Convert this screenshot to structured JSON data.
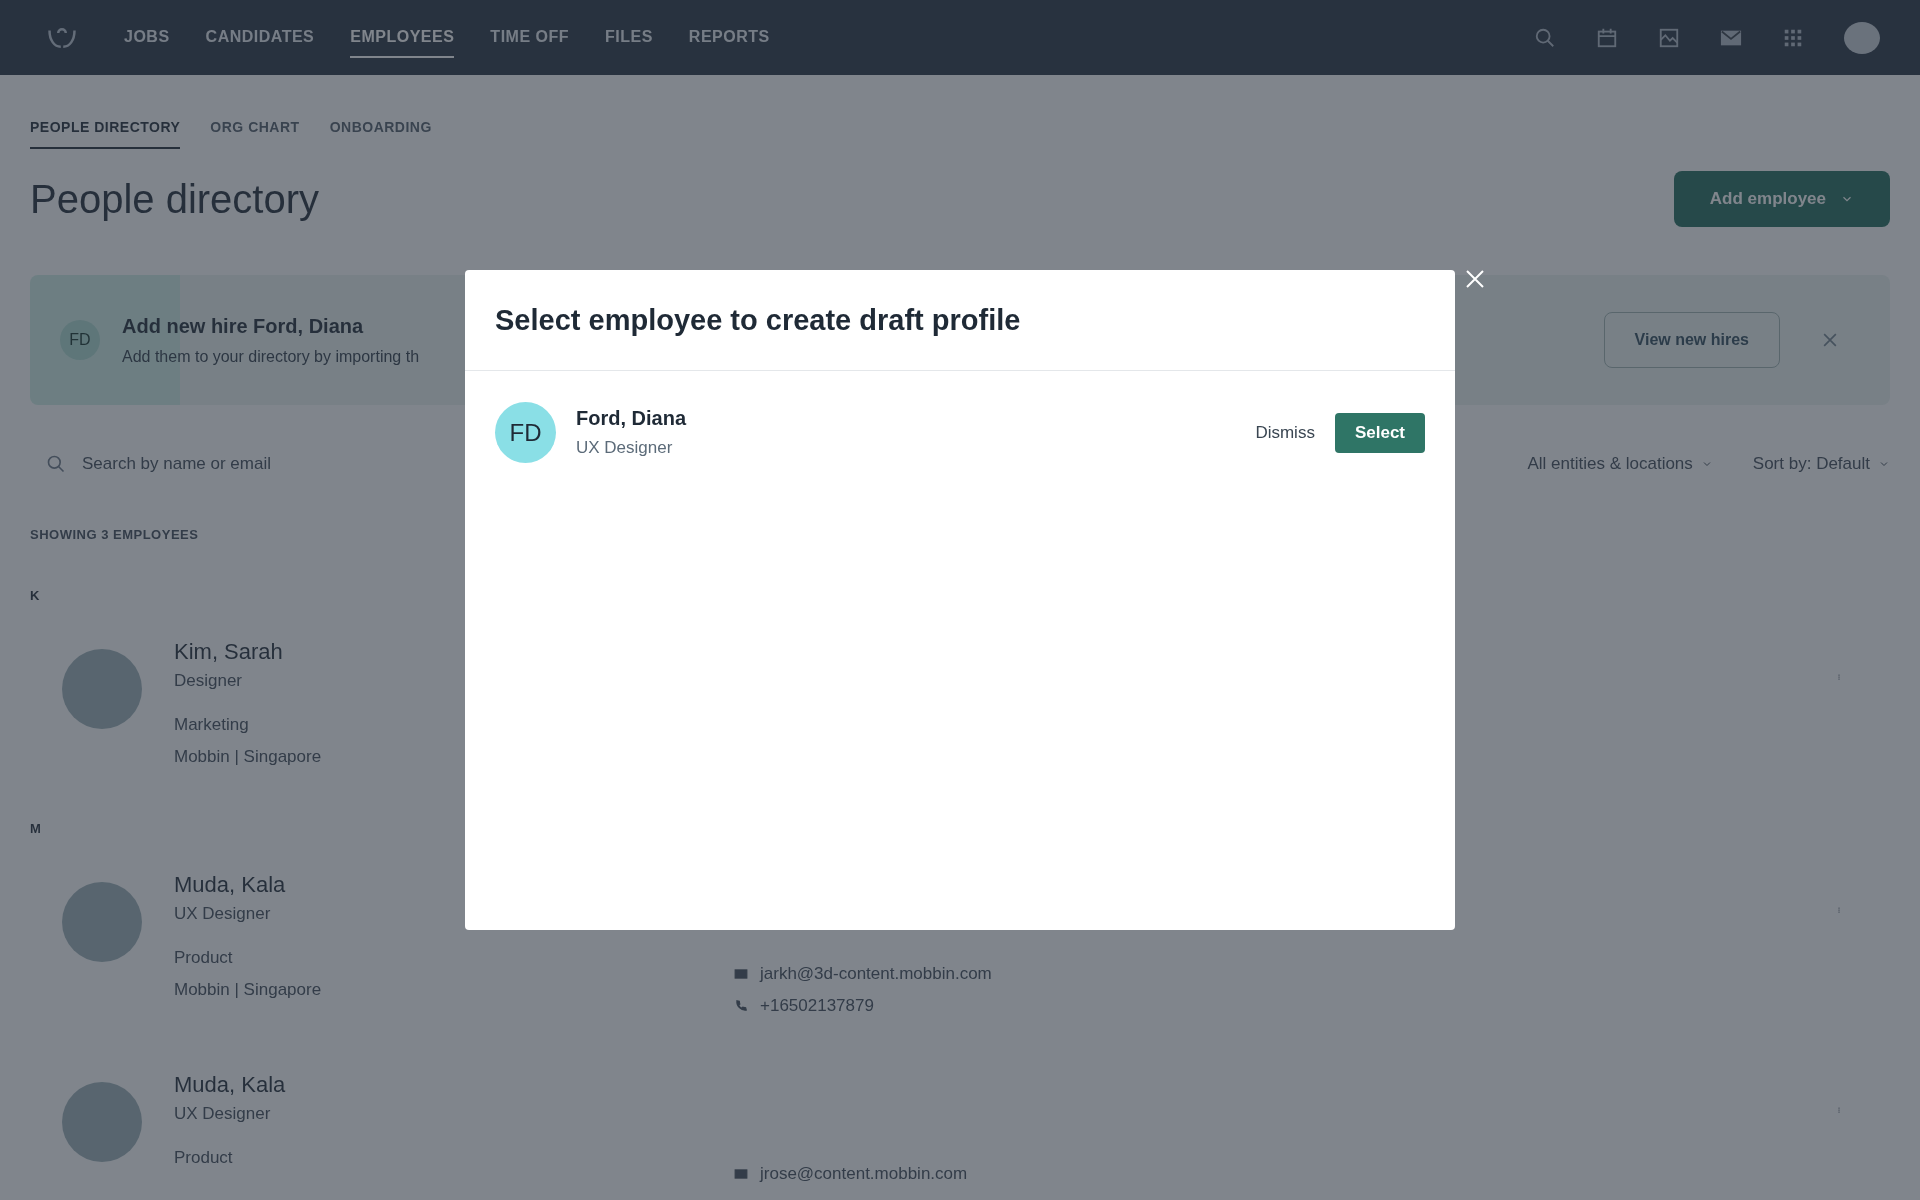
{
  "nav": {
    "items": [
      {
        "label": "JOBS",
        "selected": false
      },
      {
        "label": "CANDIDATES",
        "selected": false
      },
      {
        "label": "EMPLOYEES",
        "selected": true
      },
      {
        "label": "TIME OFF",
        "selected": false
      },
      {
        "label": "FILES",
        "selected": false
      },
      {
        "label": "REPORTS",
        "selected": false
      }
    ]
  },
  "subtabs": [
    {
      "label": "PEOPLE DIRECTORY",
      "selected": true
    },
    {
      "label": "ORG CHART",
      "selected": false
    },
    {
      "label": "ONBOARDING",
      "selected": false
    }
  ],
  "page_title": "People directory",
  "add_button": "Add employee",
  "banner": {
    "initials": "FD",
    "title": "Add new hire Ford, Diana",
    "text": "Add them to your directory by importing th",
    "button": "View new hires"
  },
  "search": {
    "placeholder": "Search by name or email"
  },
  "filters": [
    "All entities & locations",
    "Sort by: Default"
  ],
  "count": "SHOWING 3 EMPLOYEES",
  "groups": [
    {
      "letter": "K",
      "people": [
        {
          "name": "Kim, Sarah",
          "role": "Designer",
          "department": "Marketing",
          "location": "Mobbin | Singapore"
        }
      ]
    },
    {
      "letter": "M",
      "people": [
        {
          "name": "Muda, Kala",
          "role": "UX Designer",
          "department": "Product",
          "location": "Mobbin | Singapore",
          "email": "jarkh@3d-content.mobbin.com",
          "phone": "+16502137879"
        },
        {
          "name": "Muda, Kala",
          "role": "UX Designer",
          "department": "Product",
          "email": "jrose@content.mobbin.com"
        }
      ]
    }
  ],
  "modal": {
    "title": "Select employee to create draft profile",
    "employees": [
      {
        "initials": "FD",
        "name": "Ford, Diana",
        "role": "UX Designer",
        "dismiss": "Dismiss",
        "select": "Select"
      }
    ]
  }
}
